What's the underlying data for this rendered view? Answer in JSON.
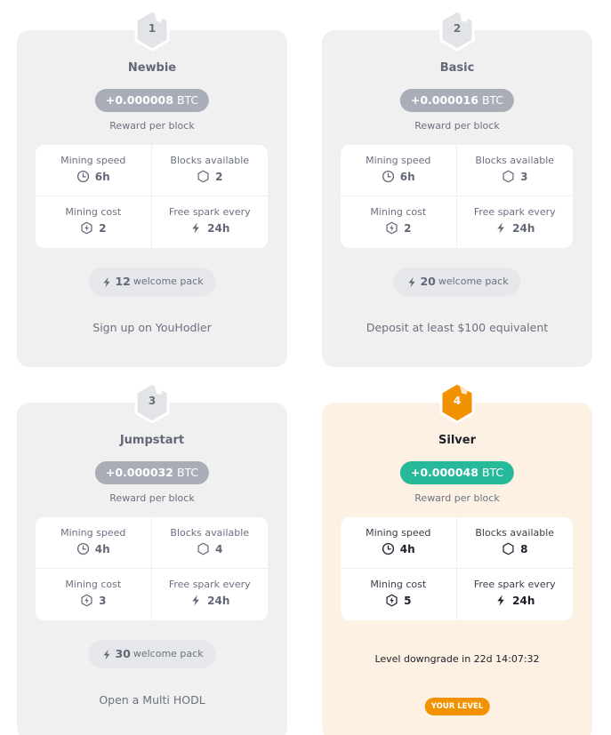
{
  "colors": {
    "card_bg": "#f0f0f0",
    "current_card_bg": "#fdf1e4",
    "reward_pill_default": "#a8adb8",
    "reward_pill_current": "#26b99a",
    "current_accent": "#f39200",
    "hex_default": "#e3e4e7"
  },
  "levels": [
    {
      "number": "1",
      "name": "Newbie",
      "reward_amount": "+0.000008",
      "reward_unit": "BTC",
      "reward_label": "Reward per block",
      "stats": {
        "mining_speed_label": "Mining speed",
        "mining_speed": "6h",
        "blocks_available_label": "Blocks available",
        "blocks_available": "2",
        "mining_cost_label": "Mining cost",
        "mining_cost": "2",
        "free_spark_label": "Free spark every",
        "free_spark": "24h"
      },
      "welcome_count": "12",
      "welcome_label": "welcome pack",
      "requirement": "Sign up on YouHodler"
    },
    {
      "number": "2",
      "name": "Basic",
      "reward_amount": "+0.000016",
      "reward_unit": "BTC",
      "reward_label": "Reward per block",
      "stats": {
        "mining_speed_label": "Mining speed",
        "mining_speed": "6h",
        "blocks_available_label": "Blocks available",
        "blocks_available": "3",
        "mining_cost_label": "Mining cost",
        "mining_cost": "2",
        "free_spark_label": "Free spark every",
        "free_spark": "24h"
      },
      "welcome_count": "20",
      "welcome_label": "welcome pack",
      "requirement": "Deposit at least $100 equivalent"
    },
    {
      "number": "3",
      "name": "Jumpstart",
      "reward_amount": "+0.000032",
      "reward_unit": "BTC",
      "reward_label": "Reward per block",
      "stats": {
        "mining_speed_label": "Mining speed",
        "mining_speed": "4h",
        "blocks_available_label": "Blocks available",
        "blocks_available": "4",
        "mining_cost_label": "Mining cost",
        "mining_cost": "3",
        "free_spark_label": "Free spark every",
        "free_spark": "24h"
      },
      "welcome_count": "30",
      "welcome_label": "welcome pack",
      "requirement": "Open a Multi HODL"
    },
    {
      "number": "4",
      "name": "Silver",
      "reward_amount": "+0.000048",
      "reward_unit": "BTC",
      "reward_label": "Reward per block",
      "stats": {
        "mining_speed_label": "Mining speed",
        "mining_speed": "4h",
        "blocks_available_label": "Blocks available",
        "blocks_available": "8",
        "mining_cost_label": "Mining cost",
        "mining_cost": "5",
        "free_spark_label": "Free spark every",
        "free_spark": "24h"
      },
      "current": true,
      "downgrade_text": "Level downgrade in 22d 14:07:32",
      "badge": "YOUR LEVEL"
    }
  ],
  "icons": {
    "level_badge": "hexagon-icon",
    "mining_speed": "clock-icon",
    "blocks_available": "hexagon-outline-icon",
    "mining_cost": "hexagon-bolt-icon",
    "free_spark": "lightning-icon",
    "welcome_pack": "lightning-icon"
  }
}
